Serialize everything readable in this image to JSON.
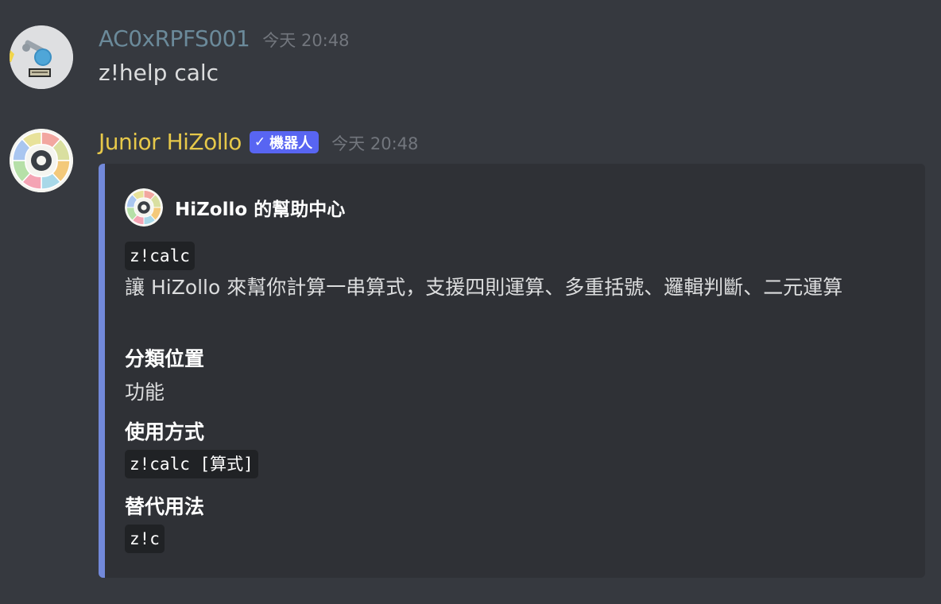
{
  "messages": [
    {
      "author": "AC0xRPFS001",
      "author_color": "#6b8a9a",
      "timestamp": "今天 20:48",
      "content": "z!help calc"
    },
    {
      "author": "Junior HiZollo",
      "author_color": "#e6c84a",
      "bot_tag": "機器人",
      "timestamp": "今天 20:48",
      "embed": {
        "accent_color": "#7289da",
        "author_name": "HiZollo 的幫助中心",
        "command": "z!calc",
        "description": "讓 HiZollo 來幫你計算一串算式，支援四則運算、多重括號、邏輯判斷、二元運算",
        "fields": [
          {
            "name": "分類位置",
            "value": "功能"
          },
          {
            "name": "使用方式",
            "value": "z!calc [算式]"
          },
          {
            "name": "替代用法",
            "value": "z!c"
          }
        ]
      }
    }
  ],
  "icons": {
    "user_avatar": "robot-arm-avatar-icon",
    "bot_avatar": "hizollo-ring-avatar-icon",
    "verified": "check-icon"
  }
}
